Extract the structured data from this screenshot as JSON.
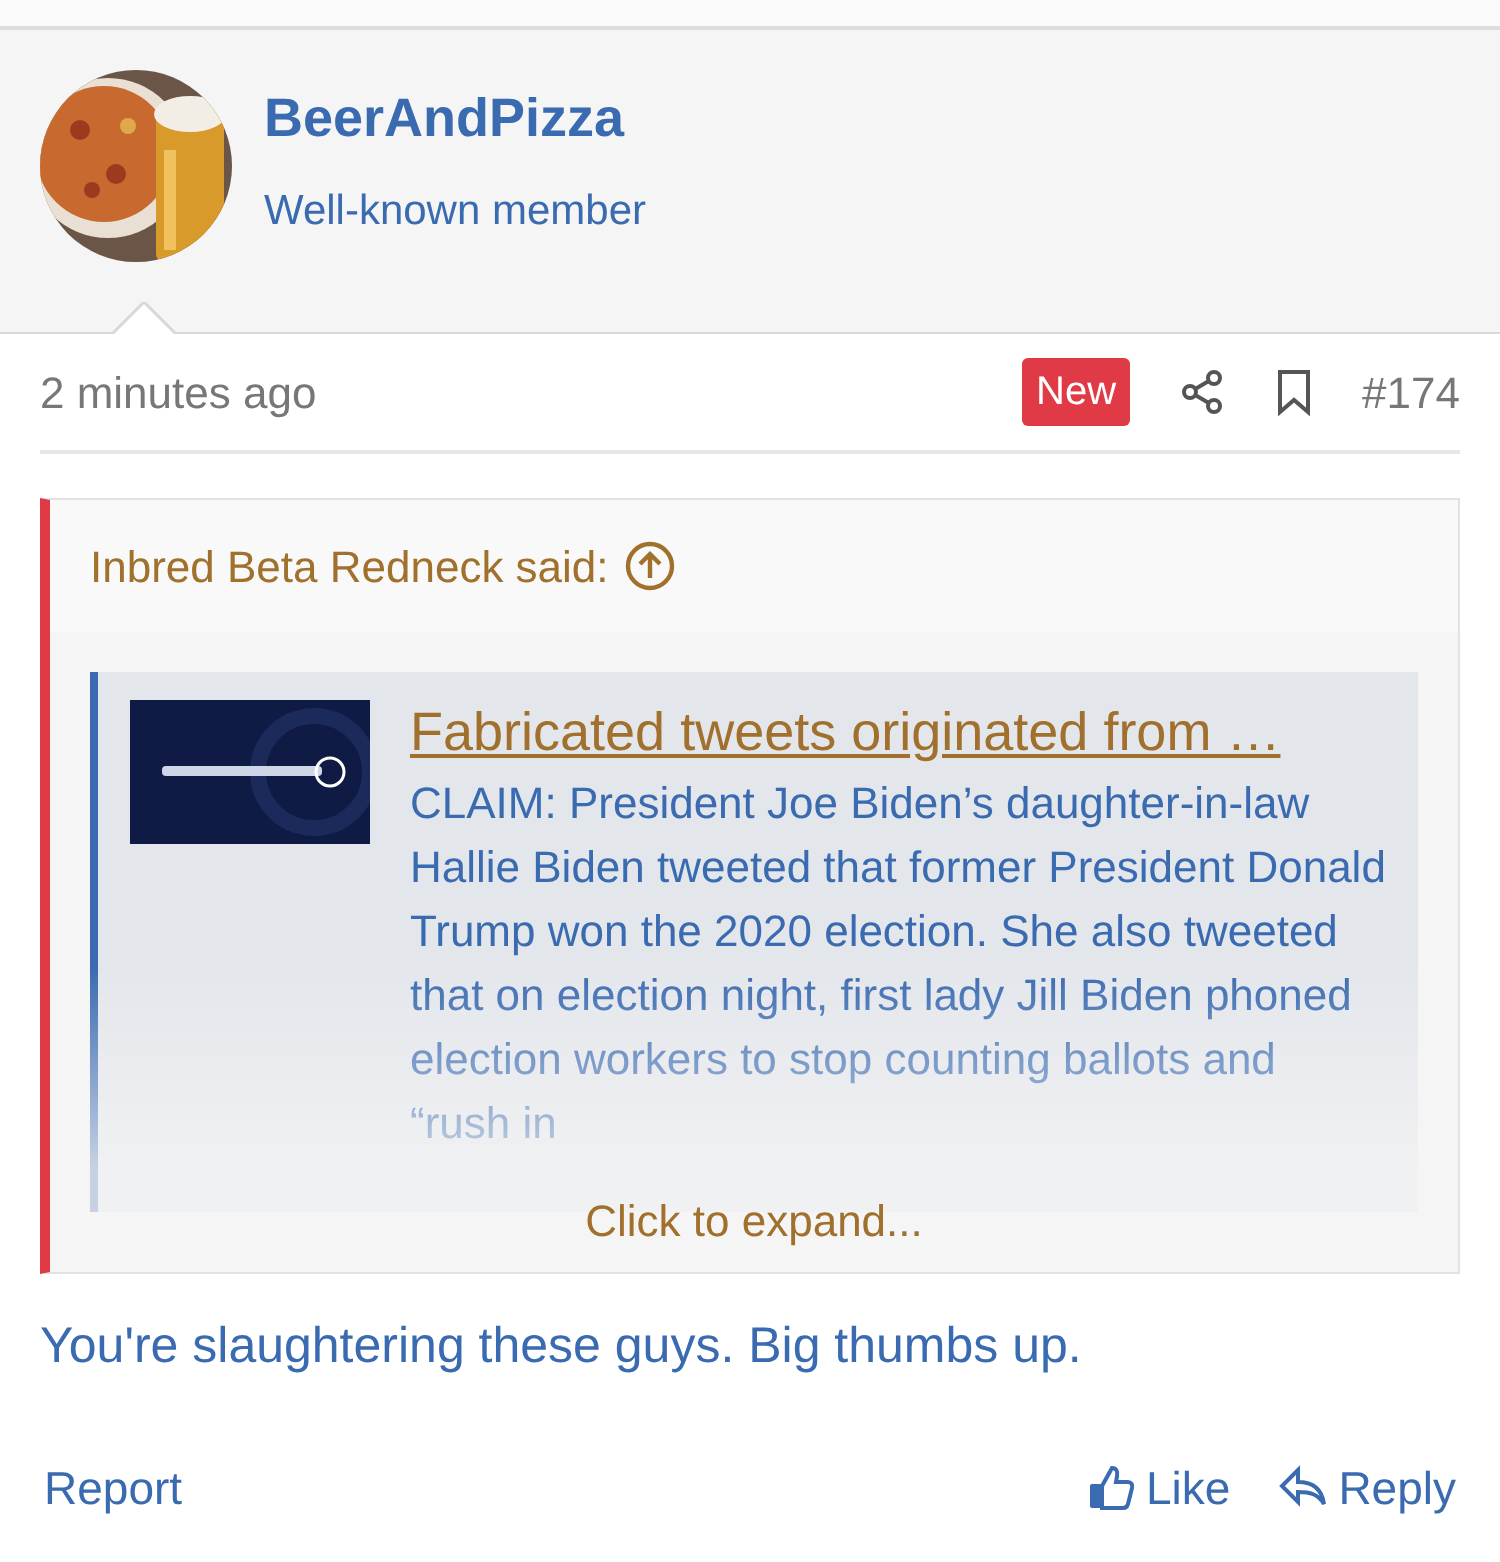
{
  "author": {
    "name": "BeerAndPizza",
    "role": "Well-known member"
  },
  "meta": {
    "time": "2 minutes ago",
    "badge": "New",
    "post_number": "#174"
  },
  "quote": {
    "attribution": "Inbred Beta Redneck said:",
    "embed": {
      "title": "Fabricated tweets originated from …",
      "description": "CLAIM: President Joe Biden’s daughter-in-law Hallie Biden tweeted that former President Donald Trump won the 2020 election. She also tweeted that on election night, first lady Jill Biden phoned election workers to stop counting ballots and “rush in"
    },
    "expand": "Click to expand..."
  },
  "message": "You're slaughtering these guys. Big thumbs up.",
  "actions": [
    {
      "kind": "report",
      "label": "Report"
    },
    {
      "kind": "like",
      "label": "Like"
    },
    {
      "kind": "reply",
      "label": "Reply"
    }
  ]
}
